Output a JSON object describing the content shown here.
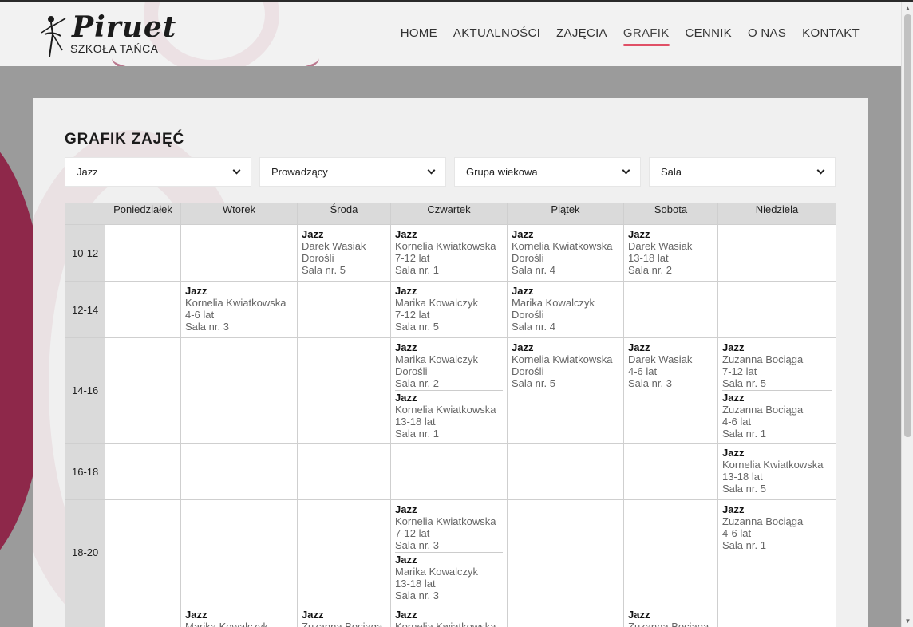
{
  "brand": {
    "name": "Piruet",
    "subtitle": "SZKOŁA TAŃCA"
  },
  "nav": [
    {
      "label": "HOME",
      "active": false
    },
    {
      "label": "AKTUALNOŚCI",
      "active": false
    },
    {
      "label": "ZAJĘCIA",
      "active": false
    },
    {
      "label": "GRAFIK",
      "active": true
    },
    {
      "label": "CENNIK",
      "active": false
    },
    {
      "label": "O NAS",
      "active": false
    },
    {
      "label": "KONTAKT",
      "active": false
    }
  ],
  "page": {
    "title": "GRAFIK ZAJĘĆ"
  },
  "filters": [
    {
      "value": "Jazz"
    },
    {
      "value": "Prowadzący"
    },
    {
      "value": "Grupa wiekowa"
    },
    {
      "value": "Sala"
    }
  ],
  "schedule": {
    "days": [
      "Poniedziałek",
      "Wtorek",
      "Środa",
      "Czwartek",
      "Piątek",
      "Sobota",
      "Niedziela"
    ],
    "rows": [
      {
        "time": "10-12",
        "cells": [
          [],
          [],
          [
            {
              "name": "Jazz",
              "teacher": "Darek Wasiak",
              "group": "Dorośli",
              "room": "Sala nr. 5"
            }
          ],
          [
            {
              "name": "Jazz",
              "teacher": "Kornelia Kwiatkowska",
              "group": "7-12 lat",
              "room": "Sala nr. 1"
            }
          ],
          [
            {
              "name": "Jazz",
              "teacher": "Kornelia Kwiatkowska",
              "group": "Dorośli",
              "room": "Sala nr. 4"
            }
          ],
          [
            {
              "name": "Jazz",
              "teacher": "Darek Wasiak",
              "group": "13-18 lat",
              "room": "Sala nr. 2"
            }
          ],
          []
        ]
      },
      {
        "time": "12-14",
        "cells": [
          [],
          [
            {
              "name": "Jazz",
              "teacher": "Kornelia Kwiatkowska",
              "group": "4-6 lat",
              "room": "Sala nr. 3"
            }
          ],
          [],
          [
            {
              "name": "Jazz",
              "teacher": "Marika Kowalczyk",
              "group": "7-12 lat",
              "room": "Sala nr. 5"
            }
          ],
          [
            {
              "name": "Jazz",
              "teacher": "Marika Kowalczyk",
              "group": "Dorośli",
              "room": "Sala nr. 4"
            }
          ],
          [],
          []
        ]
      },
      {
        "time": "14-16",
        "cells": [
          [],
          [],
          [],
          [
            {
              "name": "Jazz",
              "teacher": "Marika Kowalczyk",
              "group": "Dorośli",
              "room": "Sala nr. 2"
            },
            {
              "name": "Jazz",
              "teacher": "Kornelia Kwiatkowska",
              "group": "13-18 lat",
              "room": "Sala nr. 1"
            }
          ],
          [
            {
              "name": "Jazz",
              "teacher": "Kornelia Kwiatkowska",
              "group": "Dorośli",
              "room": "Sala nr. 5"
            }
          ],
          [
            {
              "name": "Jazz",
              "teacher": "Darek Wasiak",
              "group": "4-6 lat",
              "room": "Sala nr. 3"
            }
          ],
          [
            {
              "name": "Jazz",
              "teacher": "Zuzanna Bociąga",
              "group": "7-12 lat",
              "room": "Sala nr. 5"
            },
            {
              "name": "Jazz",
              "teacher": "Zuzanna Bociąga",
              "group": "4-6 lat",
              "room": "Sala nr. 1"
            }
          ]
        ]
      },
      {
        "time": "16-18",
        "cells": [
          [],
          [],
          [],
          [],
          [],
          [],
          [
            {
              "name": "Jazz",
              "teacher": "Kornelia Kwiatkowska",
              "group": "13-18 lat",
              "room": "Sala nr. 5"
            }
          ]
        ]
      },
      {
        "time": "18-20",
        "cells": [
          [],
          [],
          [],
          [
            {
              "name": "Jazz",
              "teacher": "Kornelia Kwiatkowska",
              "group": "7-12 lat",
              "room": "Sala nr. 3"
            },
            {
              "name": "Jazz",
              "teacher": "Marika Kowalczyk",
              "group": "13-18 lat",
              "room": "Sala nr. 3"
            }
          ],
          [],
          [],
          [
            {
              "name": "Jazz",
              "teacher": "Zuzanna Bociąga",
              "group": "4-6 lat",
              "room": "Sala nr. 1"
            }
          ]
        ]
      },
      {
        "time": "",
        "cells": [
          [],
          [
            {
              "name": "Jazz",
              "teacher": "Marika Kowalczyk",
              "group": "",
              "room": ""
            }
          ],
          [
            {
              "name": "Jazz",
              "teacher": "Zuzanna Bociąga",
              "group": "",
              "room": ""
            }
          ],
          [
            {
              "name": "Jazz",
              "teacher": "Kornelia Kwiatkowska",
              "group": "",
              "room": ""
            }
          ],
          [],
          [
            {
              "name": "Jazz",
              "teacher": "Zuzanna Bociąga",
              "group": "",
              "room": ""
            }
          ],
          []
        ]
      }
    ]
  },
  "colors": {
    "accent": "#e05066",
    "brand_deco": "#8c143c"
  }
}
